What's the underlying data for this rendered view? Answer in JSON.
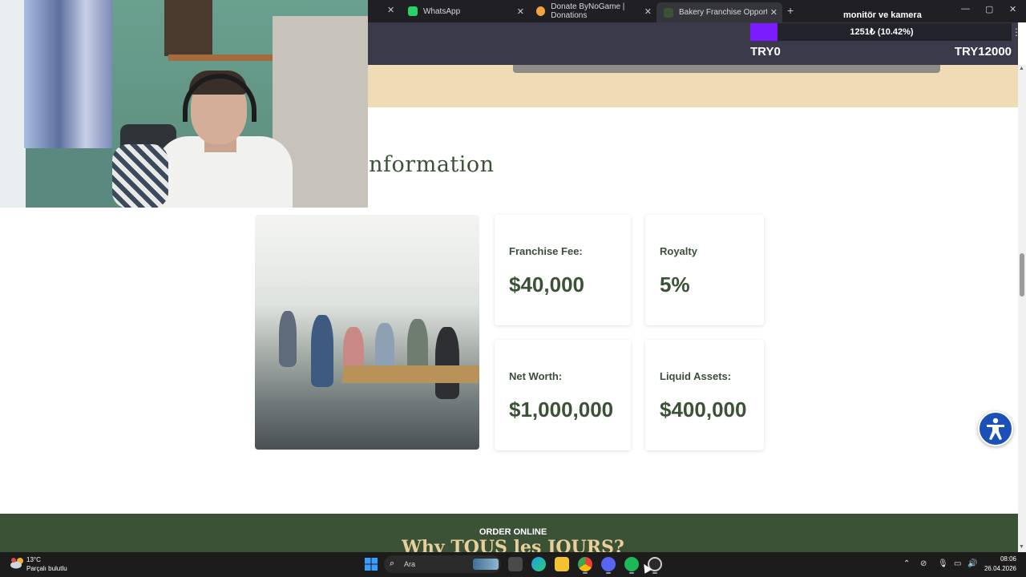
{
  "browser": {
    "tabs": [
      {
        "label": "WhatsApp",
        "color": "#25d366"
      },
      {
        "label": "Donate ByNoGame | Donations",
        "color": "#f3a43a"
      },
      {
        "label": "Bakery Franchise Opportunities",
        "color": "#3b5237"
      }
    ],
    "close_glyph": "✕",
    "new_tab_glyph": "+",
    "window_controls": [
      "—",
      "▢",
      "✕"
    ],
    "menu_glyph": "⋮"
  },
  "donation_overlay": {
    "title": "monitör ve kamera",
    "progress_text": "1251₺ (10.42%)",
    "progress_fraction": 0.1042,
    "min_label": "TRY0",
    "max_label": "TRY12000",
    "fill_color": "#7a1cff"
  },
  "page": {
    "section_title": "Information",
    "cards": [
      {
        "label": "Franchise Fee:",
        "value": "$40,000"
      },
      {
        "label": "Royalty",
        "value": "5%"
      },
      {
        "label": "Net Worth:",
        "value": "$1,000,000"
      },
      {
        "label": "Liquid Assets:",
        "value": "$400,000"
      }
    ],
    "order_online": "ORDER ONLINE",
    "why_title": "Why TOUS les JOURS?",
    "accent_color": "#3b5237",
    "beige_color": "#f0dcb4",
    "accessibility_icon": "accessibility-icon"
  },
  "taskbar": {
    "temperature": "13°C",
    "condition": "Parçalı bulutlu",
    "search_placeholder": "Ara",
    "time": "08:06",
    "date": "26.04.2026",
    "apps": [
      "task-view-icon",
      "edge-icon",
      "file-explorer-icon",
      "chrome-icon",
      "discord-icon",
      "spotify-icon",
      "obs-icon"
    ],
    "tray_icons": [
      "chevron-up-icon",
      "network-off-icon",
      "microphone-icon",
      "display-icon",
      "volume-icon"
    ]
  }
}
